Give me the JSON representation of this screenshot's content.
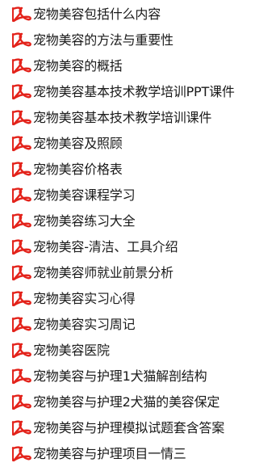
{
  "file_list": {
    "icon": "pdf-file-icon",
    "icon_color": "#e3231b",
    "text_color": "#1a1a1a",
    "items": [
      {
        "name": "宠物美容包括什么内容"
      },
      {
        "name": "宠物美容的方法与重要性"
      },
      {
        "name": "宠物美容的概括"
      },
      {
        "name": "宠物美容基本技术教学培训PPT课件"
      },
      {
        "name": "宠物美容基本技术教学培训课件"
      },
      {
        "name": "宠物美容及照顾"
      },
      {
        "name": "宠物美容价格表"
      },
      {
        "name": "宠物美容课程学习"
      },
      {
        "name": "宠物美容练习大全"
      },
      {
        "name": "宠物美容-清洁、工具介绍"
      },
      {
        "name": "宠物美容师就业前景分析"
      },
      {
        "name": "宠物美容实习心得"
      },
      {
        "name": "宠物美容实习周记"
      },
      {
        "name": "宠物美容医院"
      },
      {
        "name": "宠物美容与护理1犬猫解剖结构"
      },
      {
        "name": "宠物美容与护理2犬猫的美容保定"
      },
      {
        "name": "宠物美容与护理模拟试题套含答案"
      },
      {
        "name": "宠物美容与护理项目一情三"
      }
    ]
  }
}
